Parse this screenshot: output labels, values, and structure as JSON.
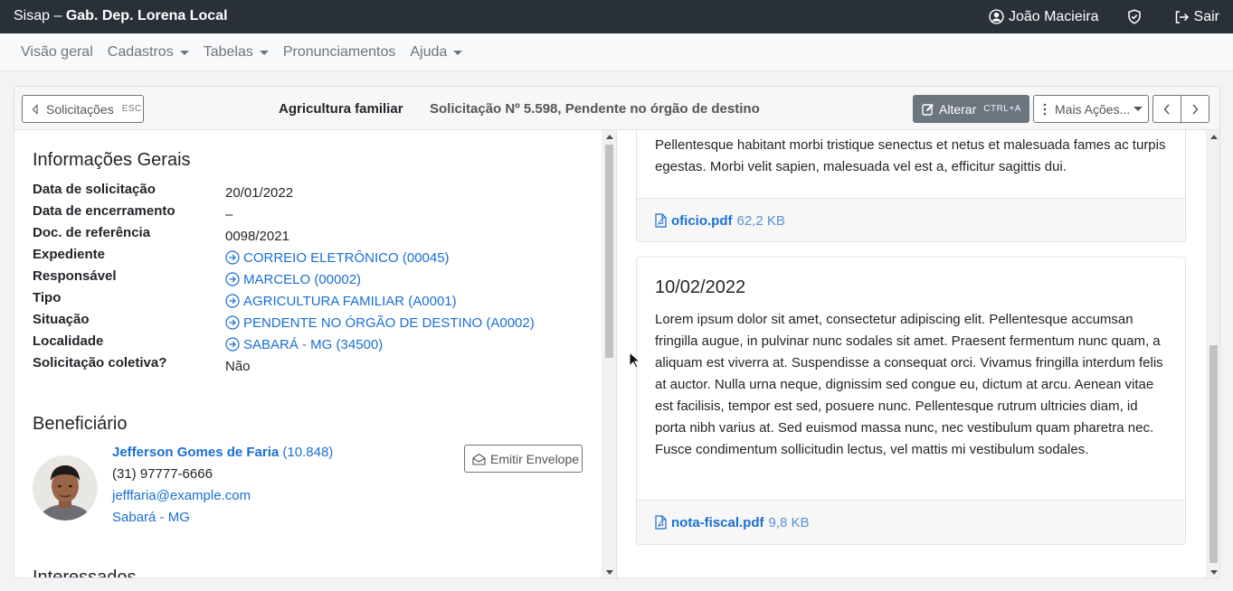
{
  "topbar": {
    "app": "Sisap",
    "separator": " – ",
    "office": "Gab. Dep. Lorena Local",
    "user": "João Macieira",
    "logout": "Sair"
  },
  "menu": {
    "items": [
      {
        "label": "Visão geral",
        "dropdown": false
      },
      {
        "label": "Cadastros",
        "dropdown": true
      },
      {
        "label": "Tabelas",
        "dropdown": true
      },
      {
        "label": "Pronunciamentos",
        "dropdown": false
      },
      {
        "label": "Ajuda",
        "dropdown": true
      }
    ]
  },
  "header": {
    "back_label": "Solicitações",
    "back_key": "ESC",
    "title": "Agricultura familiar",
    "subtitle": "Solicitação Nº 5.598, Pendente no órgão de destino",
    "edit_label": "Alterar",
    "edit_key": "CTRL+A",
    "more_label": "Mais Ações..."
  },
  "info": {
    "title": "Informações Gerais",
    "rows": [
      {
        "label": "Data de solicitação",
        "value": "20/01/2022",
        "link": false
      },
      {
        "label": "Data de encerramento",
        "value": "–",
        "link": false
      },
      {
        "label": "Doc. de referência",
        "value": "0098/2021",
        "link": false
      },
      {
        "label": "Expediente",
        "value": "CORREIO ELETRÔNICO (00045)",
        "link": true
      },
      {
        "label": "Responsável",
        "value": "MARCELO (00002)",
        "link": true
      },
      {
        "label": "Tipo",
        "value": "AGRICULTURA FAMILIAR (A0001)",
        "link": true
      },
      {
        "label": "Situação",
        "value": "PENDENTE NO ÓRGÃO DE DESTINO (A0002)",
        "link": true
      },
      {
        "label": "Localidade",
        "value": "SABARÁ - MG (34500)",
        "link": true
      },
      {
        "label": "Solicitação coletiva?",
        "value": "Não",
        "link": false
      }
    ]
  },
  "beneficiary": {
    "title": "Beneficiário",
    "name": "Jefferson Gomes de Faria",
    "id": "(10.848)",
    "phone": "(31) 97777-6666",
    "email": "jefffaria@example.com",
    "city": "Sabará - MG",
    "envelope_label": "Emitir Envelope"
  },
  "next_section": {
    "title": "Interessados"
  },
  "documents": [
    {
      "date": "",
      "text": "Pellentesque habitant morbi tristique senectus et netus et malesuada fames ac turpis egestas. Morbi velit sapien, malesuada vel est a, efficitur sagittis dui.",
      "file": "oficio.pdf",
      "size": "62,2 KB"
    },
    {
      "date": "10/02/2022",
      "text": "Lorem ipsum dolor sit amet, consectetur adipiscing elit. Pellentesque accumsan fringilla augue, in pulvinar nunc sodales sit amet. Praesent fermentum nunc quam, a aliquam est viverra at. Suspendisse a consequat orci. Vivamus fringilla interdum felis at auctor. Nulla urna neque, dignissim sed congue eu, dictum at arcu. Aenean vitae est facilisis, tempor est sed, posuere nunc. Pellentesque rutrum ultricies diam, id porta nibh varius at. Sed euismod massa nunc, nec vestibulum quam pharetra nec. Fusce condimentum sollicitudin lectus, vel mattis mi vestibulum sodales.",
      "file": "nota-fiscal.pdf",
      "size": "9,8 KB"
    }
  ],
  "icons": {
    "user": "user-circle-icon",
    "shield": "shield-check-icon",
    "logout": "logout-icon",
    "back": "chevron-left-icon",
    "edit": "edit-icon",
    "more": "kebab-icon",
    "link": "arrow-circle-right-icon",
    "pdf": "file-pdf-icon",
    "envelope": "envelope-open-icon"
  },
  "colors": {
    "topbar": "#2a3038",
    "link": "#1a6fd1",
    "secondary": "#6c757d"
  }
}
